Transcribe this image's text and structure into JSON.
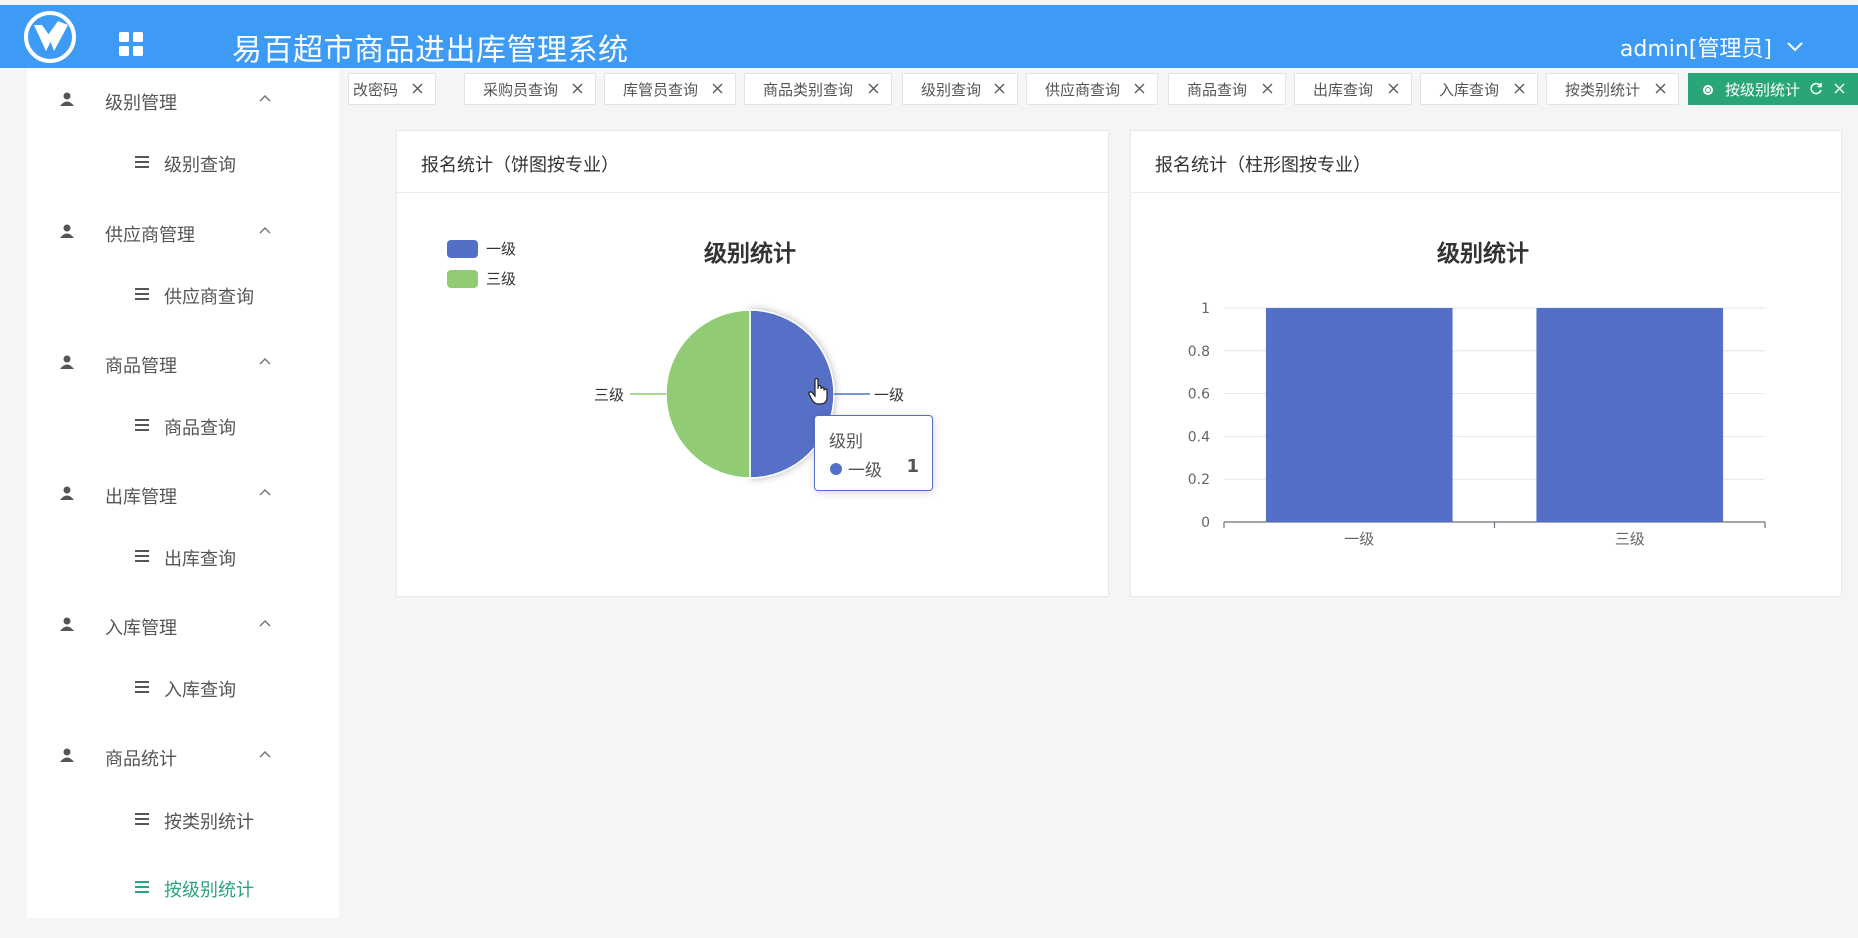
{
  "header": {
    "title": "易百超市商品进出库管理系统",
    "user": "admin[管理员]",
    "accent": "#3d9bf5"
  },
  "sidebar": {
    "groups": [
      {
        "label": "级别管理",
        "icon": "person-icon",
        "items": [
          {
            "label": "级别查询"
          }
        ]
      },
      {
        "label": "供应商管理",
        "icon": "person-icon",
        "items": [
          {
            "label": "供应商查询"
          }
        ]
      },
      {
        "label": "商品管理",
        "icon": "person-icon",
        "items": [
          {
            "label": "商品查询"
          }
        ]
      },
      {
        "label": "出库管理",
        "icon": "person-icon",
        "items": [
          {
            "label": "出库查询"
          }
        ]
      },
      {
        "label": "入库管理",
        "icon": "person-icon",
        "items": [
          {
            "label": "入库查询"
          }
        ]
      },
      {
        "label": "商品统计",
        "icon": "person-icon",
        "items": [
          {
            "label": "按类别统计"
          },
          {
            "label": "按级别统计",
            "active": true
          }
        ]
      }
    ],
    "active_color": "#2aa578"
  },
  "tabs": [
    {
      "label": "改密码"
    },
    {
      "label": "采购员查询"
    },
    {
      "label": "库管员查询"
    },
    {
      "label": "商品类别查询"
    },
    {
      "label": "级别查询"
    },
    {
      "label": "供应商查询"
    },
    {
      "label": "商品查询"
    },
    {
      "label": "出库查询"
    },
    {
      "label": "入库查询"
    },
    {
      "label": "按类别统计"
    },
    {
      "label": "按级别统计",
      "active": true
    }
  ],
  "pie_card": {
    "header": "报名统计（饼图按专业）",
    "chart_title": "级别统计",
    "legend": [
      "一级",
      "三级"
    ],
    "labels": [
      "一级",
      "三级"
    ],
    "tooltip": {
      "title": "级别",
      "name": "一级",
      "value": "1"
    }
  },
  "bar_card": {
    "header": "报名统计（柱形图按专业）",
    "chart_title": "级别统计",
    "y_ticks": [
      "1",
      "0.8",
      "0.6",
      "0.4",
      "0.2",
      "0"
    ],
    "x_ticks": [
      "一级",
      "三级"
    ]
  },
  "chart_data": [
    {
      "type": "pie",
      "title": "级别统计",
      "categories": [
        "一级",
        "三级"
      ],
      "values": [
        1,
        1
      ],
      "colors": [
        "#5470c6",
        "#91cc75"
      ],
      "legend": "top-left"
    },
    {
      "type": "bar",
      "title": "级别统计",
      "categories": [
        "一级",
        "三级"
      ],
      "values": [
        1,
        1
      ],
      "ylim": [
        0,
        1
      ],
      "grid": true,
      "color": "#5470c6"
    }
  ]
}
